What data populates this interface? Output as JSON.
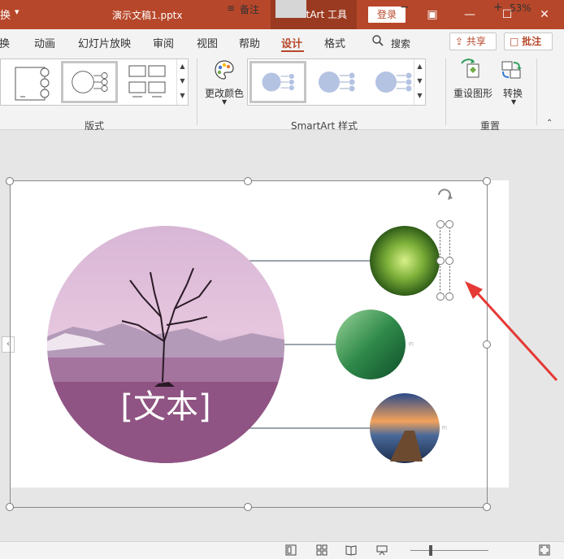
{
  "titlebar": {
    "left_fragment": "换",
    "title": "演示文稿1.pptx",
    "smartart_tools": "SmartArt 工具",
    "login": "登录",
    "restore_ribbon": "▣",
    "minimize": "—",
    "maximize": "☐",
    "close": "✕"
  },
  "menu": {
    "items": [
      "切换",
      "动画",
      "幻灯片放映",
      "审阅",
      "视图",
      "帮助",
      "设计",
      "格式"
    ],
    "search": "搜索",
    "share": "共享",
    "comments": "批注"
  },
  "ribbon": {
    "layout_group": "版式",
    "change_colors": "更改颜色",
    "styles_group": "SmartArt 样式",
    "reset_graphic": "重设图形",
    "convert": "转换",
    "reset_group": "重置"
  },
  "slide": {
    "placeholder_text": "[文本]"
  },
  "statusbar": {
    "notes": "备注",
    "zoom": "53%"
  },
  "colors": {
    "accent": "#b7472a",
    "style_circle": "#b4c3e2"
  }
}
